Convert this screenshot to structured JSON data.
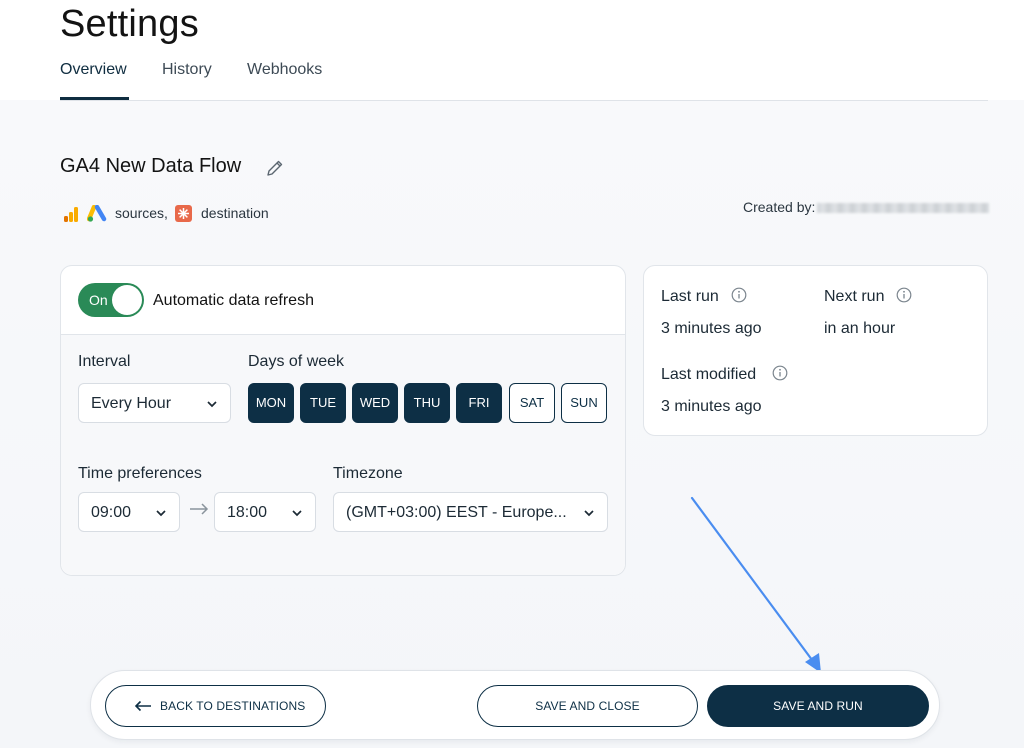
{
  "page": {
    "title": "Settings"
  },
  "tabs": [
    {
      "label": "Overview",
      "active": true
    },
    {
      "label": "History",
      "active": false
    },
    {
      "label": "Webhooks",
      "active": false
    }
  ],
  "flow": {
    "name": "GA4 New Data Flow",
    "edit_icon": "pencil-icon",
    "sources_label": "sources,",
    "destination_label": "destination",
    "source_icons": [
      "google-analytics-icon",
      "google-ads-icon"
    ],
    "destination_icon": "destination-icon",
    "created_by_label": "Created by:"
  },
  "refresh": {
    "toggle_label": "On",
    "toggle_on": true,
    "title": "Automatic data refresh",
    "interval_label": "Interval",
    "interval_value": "Every Hour",
    "days_label": "Days of week",
    "days": [
      {
        "label": "MON",
        "selected": true
      },
      {
        "label": "TUE",
        "selected": true
      },
      {
        "label": "WED",
        "selected": true
      },
      {
        "label": "THU",
        "selected": true
      },
      {
        "label": "FRI",
        "selected": true
      },
      {
        "label": "SAT",
        "selected": false
      },
      {
        "label": "SUN",
        "selected": false
      }
    ],
    "time_label": "Time preferences",
    "time_from": "09:00",
    "time_to": "18:00",
    "timezone_label": "Timezone",
    "timezone_value": "(GMT+03:00) EEST - Europe..."
  },
  "stats": {
    "last_run_label": "Last run",
    "last_run_value": "3 minutes ago",
    "next_run_label": "Next run",
    "next_run_value": "in an hour",
    "last_modified_label": "Last modified",
    "last_modified_value": "3 minutes ago"
  },
  "footer": {
    "back_label": "BACK TO DESTINATIONS",
    "save_close_label": "SAVE AND CLOSE",
    "save_run_label": "SAVE AND RUN"
  },
  "colors": {
    "primary": "#0d2f45",
    "toggle_on": "#2a8a57",
    "annotation_arrow": "#4a8df0"
  }
}
